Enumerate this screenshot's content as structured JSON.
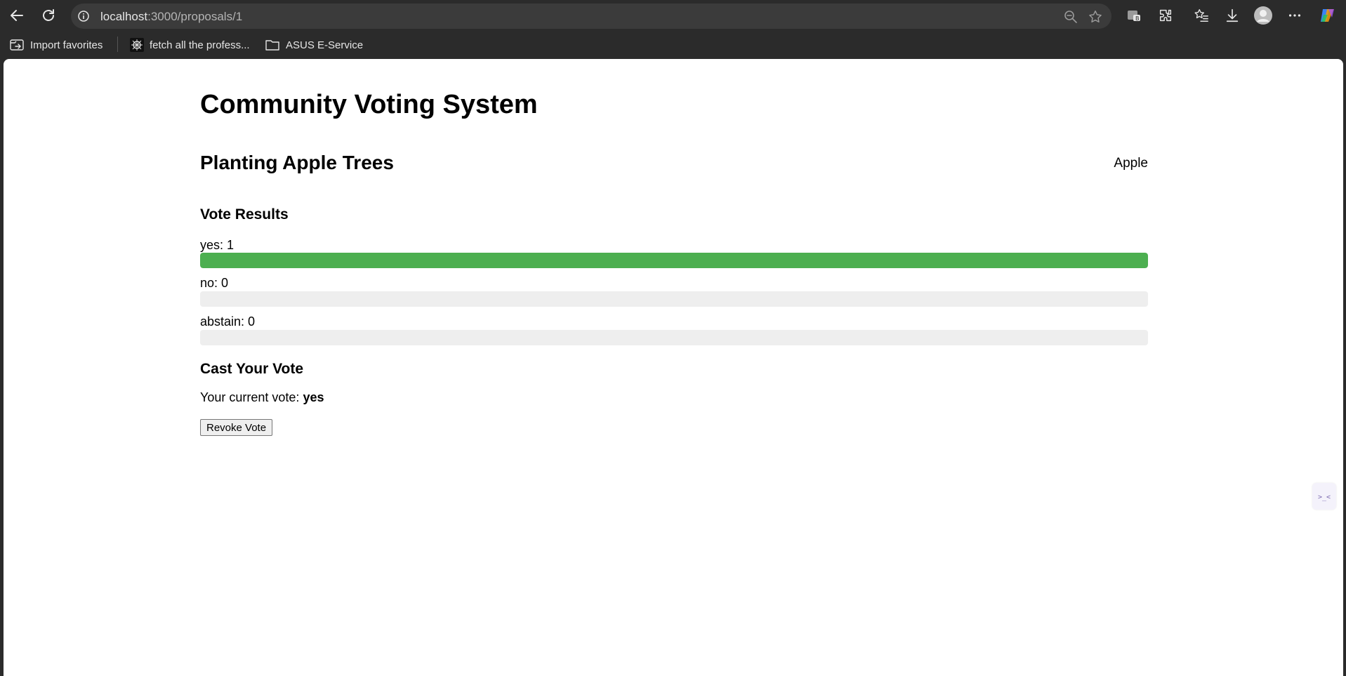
{
  "browser": {
    "url_host": "localhost",
    "url_path": ":3000/proposals/1",
    "bookmarks": [
      {
        "label": "Import favorites",
        "icon": "import-icon"
      },
      {
        "label": "fetch all the profess...",
        "icon": "site-favicon-icon"
      },
      {
        "label": "ASUS E-Service",
        "icon": "folder-icon"
      }
    ]
  },
  "page": {
    "app_title": "Community Voting System",
    "proposal_title": "Planting Apple Trees",
    "proposal_tag": "Apple",
    "results_heading": "Vote Results",
    "results": [
      {
        "label": "yes: 1",
        "fraction": 1.0
      },
      {
        "label": "no: 0",
        "fraction": 0.0
      },
      {
        "label": "abstain: 0",
        "fraction": 0.0
      }
    ],
    "cast_heading": "Cast Your Vote",
    "current_vote_prefix": "Your current vote:",
    "current_vote_value": "yes",
    "revoke_label": "Revoke Vote"
  },
  "colors": {
    "bar_fill": "#4caf50",
    "bar_track": "#eeeeee",
    "chrome_bg": "#2b2b2b"
  }
}
